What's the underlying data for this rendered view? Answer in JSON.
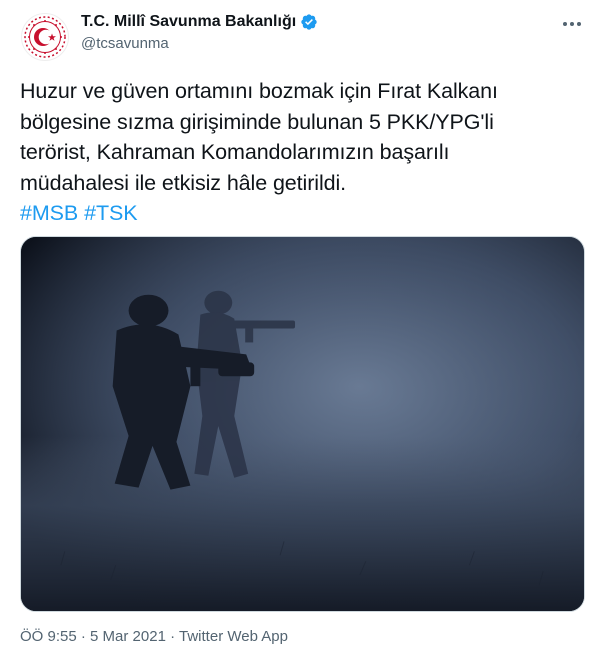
{
  "author": {
    "display_name": "T.C. Millî Savunma Bakanlığı",
    "handle": "@tcsavunma",
    "verified": true,
    "avatar_icon": "crescent-star-emblem-icon",
    "accent": "#c8102e"
  },
  "tweet": {
    "lines": [
      "Huzur ve güven ortamını bozmak için Fırat Kalkanı",
      "bölgesine sızma girişiminde bulunan 5 PKK/YPG'li",
      "terörist, Kahraman Komandolarımızın başarılı",
      "müdahalesi ile etkisiz hâle getirildi."
    ],
    "hashtags": [
      "#MSB",
      "#TSK"
    ],
    "hashtag_color": "#1d9bf0"
  },
  "media": {
    "icon": "soldiers-photo",
    "tone": "#3c4a62"
  },
  "meta": {
    "time": "ÖÖ 9:55",
    "separator": "·",
    "date": "5 Mar 2021",
    "source": "Twitter Web App"
  },
  "icons": {
    "verified": "verified-badge-icon",
    "more": "more-options-icon"
  }
}
